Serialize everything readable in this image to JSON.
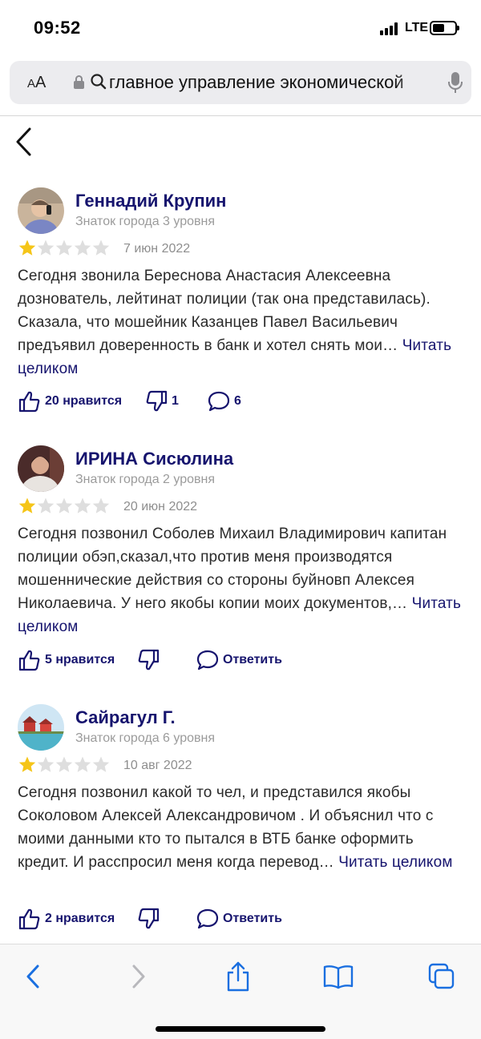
{
  "status_bar": {
    "time": "09:52",
    "network": "LTE",
    "battery_fraction": 0.55
  },
  "url_bar": {
    "text_size_label": "AA",
    "url_text": "главное управление экономической"
  },
  "reviews": [
    {
      "name": "Геннадий Крупин",
      "level": "Знаток города 3 уровня",
      "rating": 1,
      "max_rating": 5,
      "date": "7 июн 2022",
      "text": "Сегодня звонила Береснова Анастасия Алексеевна дознователь, лейтинат полиции (так она представилась). Сказала, что мошейник Казанцев Павел Васильевич предъявил доверенность в банк и хотел снять мои…",
      "read_more": "Читать целиком",
      "likes": "20 нравится",
      "dislikes": "1",
      "third_action": "6"
    },
    {
      "name": "ИРИНА Сисюлина",
      "level": "Знаток города 2 уровня",
      "rating": 1,
      "max_rating": 5,
      "date": "20 июн 2022",
      "text": "Сегодня позвонил Соболев Михаил Владимирович капитан полиции обэп,сказал,что против меня производятся мошеннические действия со стороны буйновп Алексея Николаевича. У него якобы копии моих документов,…",
      "read_more": "Читать целиком",
      "likes": "5 нравится",
      "dislikes": "",
      "third_action": "Ответить"
    },
    {
      "name": "Сайрагул Г.",
      "level": "Знаток города 6 уровня",
      "rating": 1,
      "max_rating": 5,
      "date": "10 авг 2022",
      "text": "Сегодня позвонил какой то чел, и представился якобы Соколовом Алексей Александровичом . И объяснил что с моими данными кто то пытался в ВТБ банке оформить кредит. И расспросил меня когда перевод…",
      "read_more": "Читать целиком",
      "likes": "2 нравится",
      "dislikes": "",
      "third_action": "Ответить"
    }
  ],
  "colors": {
    "accent": "#16146e",
    "star_filled": "#f5c518",
    "star_empty": "#dedede",
    "muted": "#9b9b9b",
    "toolbar_icon": "#1a6fe0"
  },
  "toolbar": {
    "icons": [
      "back-icon",
      "forward-icon",
      "share-icon",
      "bookmarks-icon",
      "tabs-icon"
    ]
  }
}
